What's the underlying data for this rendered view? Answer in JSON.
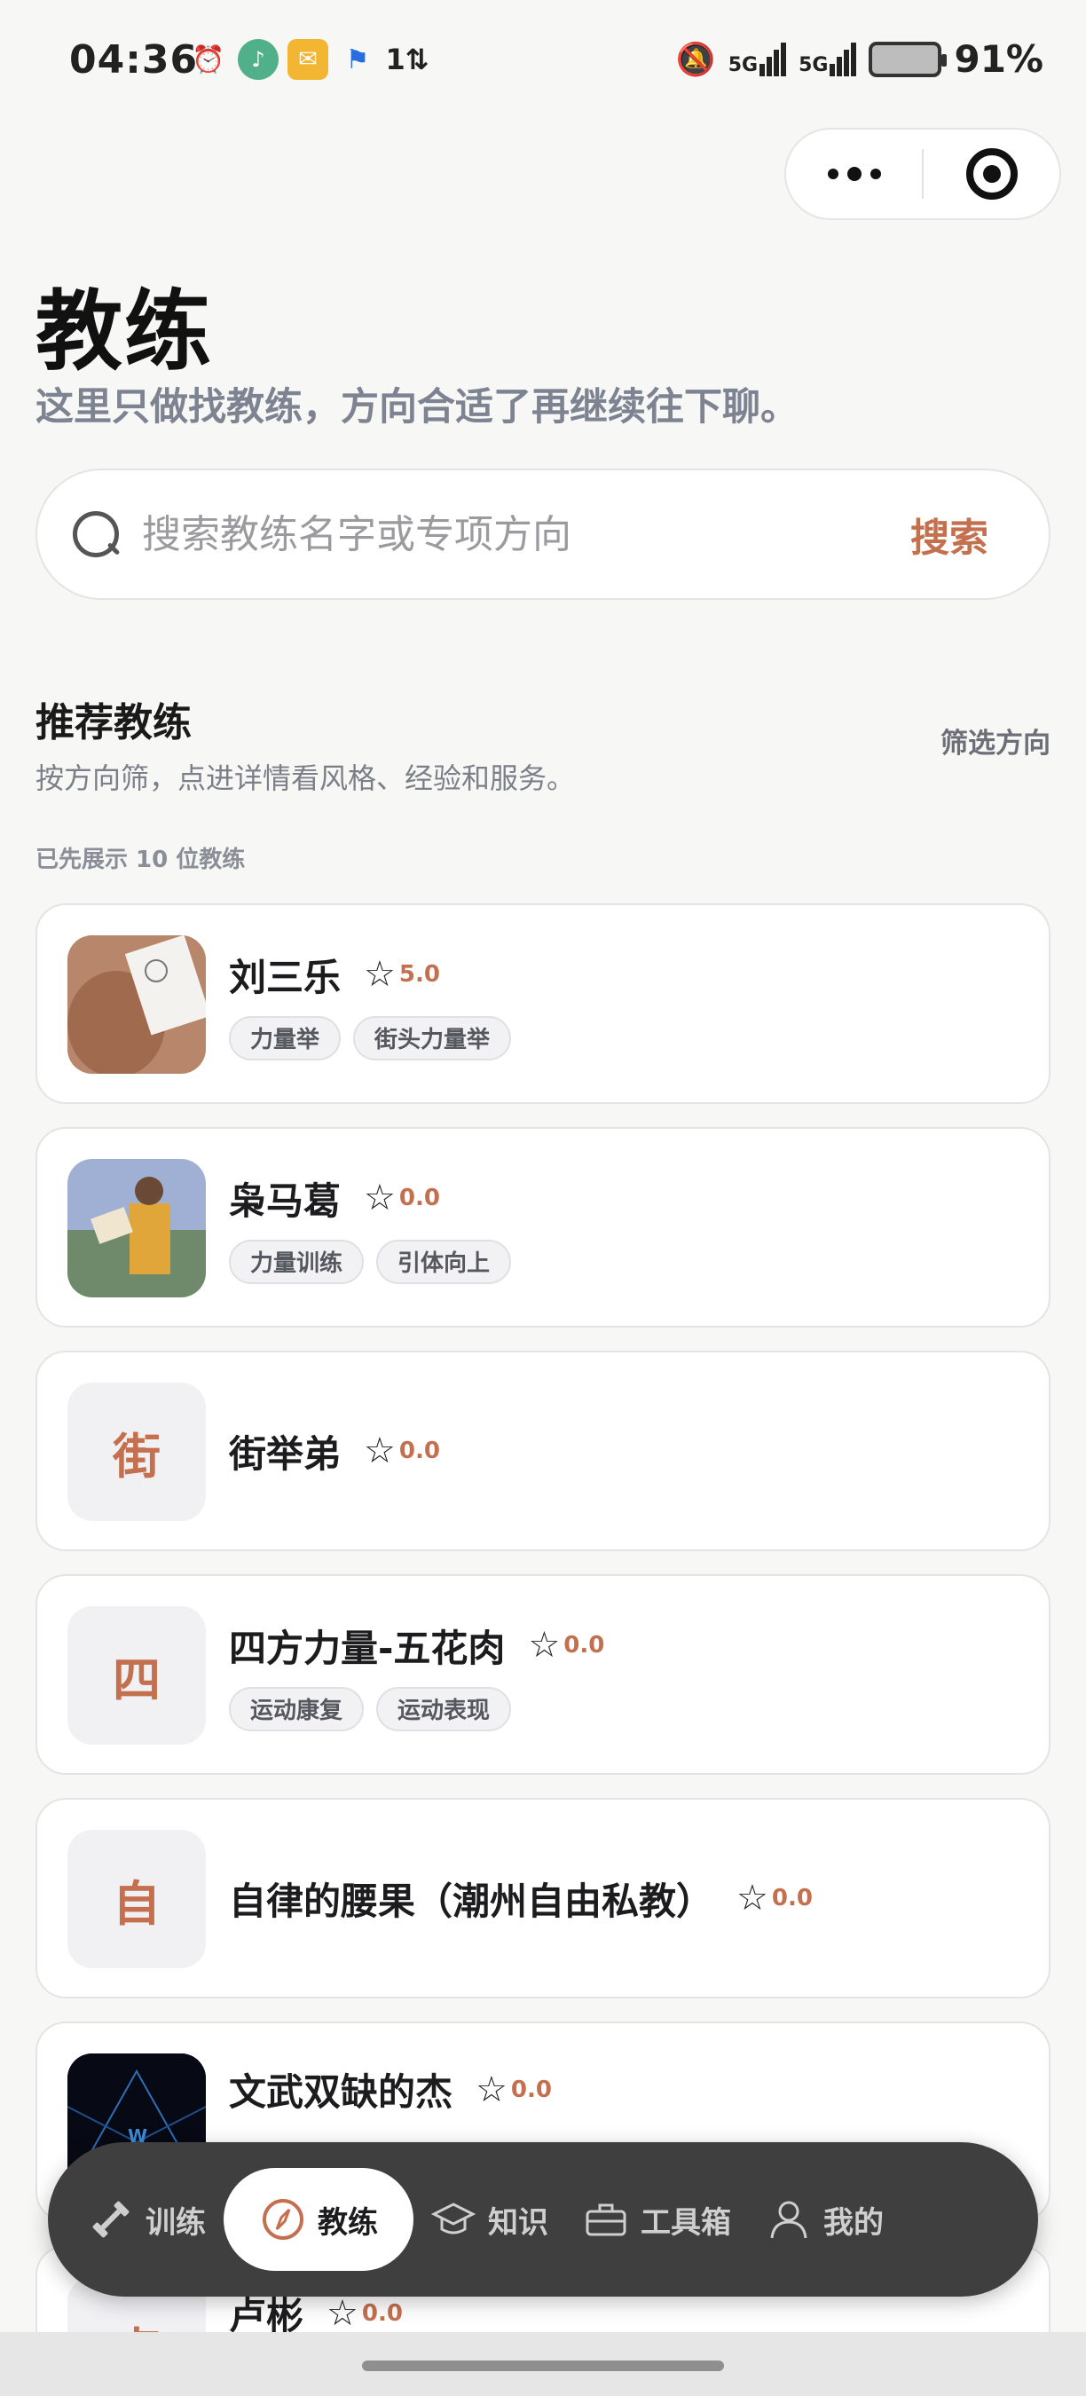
{
  "status_bar": {
    "time": "04:36",
    "network_1": "5G",
    "network_2": "5G",
    "battery": "91%"
  },
  "capsule": {
    "more_label": "more",
    "target_label": "close"
  },
  "header": {
    "title": "教练",
    "subtitle": "这里只做找教练，方向合适了再继续往下聊。"
  },
  "search": {
    "placeholder": "搜索教练名字或专项方向",
    "button_label": "搜索"
  },
  "section": {
    "title": "推荐教练",
    "description": "按方向筛，点进详情看风格、经验和服务。",
    "filter_label": "筛选方向",
    "count_note": "已先展示 10 位教练"
  },
  "coaches": [
    {
      "name": "刘三乐",
      "rating": "5.0",
      "avatar_type": "photo",
      "tags": [
        "力量举",
        "街头力量举"
      ]
    },
    {
      "name": "枭马葛",
      "rating": "0.0",
      "avatar_type": "photo",
      "tags": [
        "力量训练",
        "引体向上"
      ]
    },
    {
      "name": "街举弟",
      "rating": "0.0",
      "avatar_type": "initial",
      "initial": "街",
      "tags": []
    },
    {
      "name": "四方力量-五花肉",
      "rating": "0.0",
      "avatar_type": "initial",
      "initial": "四",
      "tags": [
        "运动康复",
        "运动表现"
      ]
    },
    {
      "name": "自律的腰果（潮州自由私教）",
      "rating": "0.0",
      "avatar_type": "initial",
      "initial": "自",
      "tags": []
    },
    {
      "name": "文武双缺的杰",
      "rating": "0.0",
      "avatar_type": "photo",
      "tags": []
    },
    {
      "name": "卢彬",
      "rating": "0.0",
      "avatar_type": "initial",
      "initial": "卢",
      "tags": []
    }
  ],
  "bottom_nav": {
    "items": [
      {
        "label": "训练",
        "icon": "dumbbell-icon",
        "active": false
      },
      {
        "label": "教练",
        "icon": "compass-icon",
        "active": true
      },
      {
        "label": "知识",
        "icon": "graduation-cap-icon",
        "active": false
      },
      {
        "label": "工具箱",
        "icon": "toolbox-icon",
        "active": false
      },
      {
        "label": "我的",
        "icon": "user-icon",
        "active": false
      }
    ]
  },
  "colors": {
    "accent": "#c4704f",
    "background": "#f7f7f5",
    "nav_background": "#3f3f3f"
  }
}
